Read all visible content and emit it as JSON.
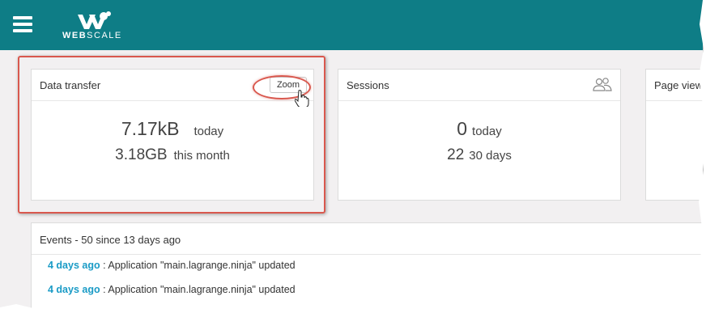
{
  "header": {
    "brand": {
      "bold": "WEB",
      "rest": "SCALE"
    },
    "menu_icon": "hamburger-menu-icon",
    "color": "#0e7d86"
  },
  "cards": {
    "data_transfer": {
      "title": "Data transfer",
      "zoom_label": "Zoom",
      "today_value": "7.17kB",
      "today_label": "today",
      "month_value": "3.18GB",
      "month_label": "this month"
    },
    "sessions": {
      "title": "Sessions",
      "icon": "users-icon",
      "today_value": "0",
      "today_label": "today",
      "period_value": "22",
      "period_label": "30 days"
    },
    "page_views": {
      "title": "Page view"
    }
  },
  "events": {
    "title": "Events - 50 since 13 days ago",
    "items": [
      {
        "time": "4 days ago",
        "text": " : Application \"main.lagrange.ninja\" updated"
      },
      {
        "time": "4 days ago",
        "text": " : Application \"main.lagrange.ninja\" updated"
      }
    ]
  },
  "annotation_color": "#d9584e",
  "link_color": "#1a9bc6"
}
